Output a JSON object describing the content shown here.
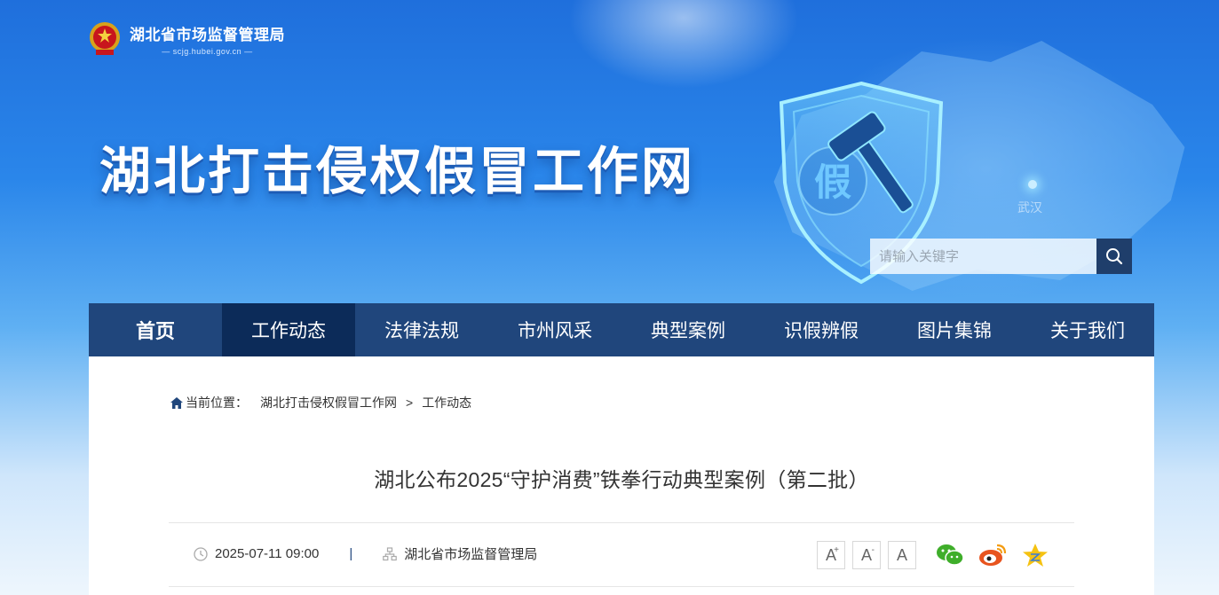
{
  "header": {
    "agency_name": "湖北省市场监督管理局",
    "agency_url": "— scjg.hubei.gov.cn —",
    "site_title": "湖北打击侵权假冒工作网",
    "map_label": "武汉",
    "shield_char": "假"
  },
  "search": {
    "placeholder": "请输入关键字"
  },
  "nav": {
    "items": [
      {
        "label": "首页"
      },
      {
        "label": "工作动态"
      },
      {
        "label": "法律法规"
      },
      {
        "label": "市州风采"
      },
      {
        "label": "典型案例"
      },
      {
        "label": "识假辨假"
      },
      {
        "label": "图片集锦"
      },
      {
        "label": "关于我们"
      }
    ],
    "active_index": 1
  },
  "breadcrumb": {
    "label": "当前位置：",
    "items": [
      "湖北打击侵权假冒工作网",
      "工作动态"
    ],
    "separator": ">"
  },
  "article": {
    "title": "湖北公布2025“守护消费”铁拳行动典型案例（第二批）",
    "date": "2025-07-11 09:00",
    "divider": "|",
    "source": "湖北省市场监督管理局"
  },
  "font_controls": {
    "increase": "A",
    "decrease": "A",
    "reset": "A",
    "increase_sup": "+",
    "decrease_sup": "-"
  },
  "share": {
    "icons": [
      "wechat-icon",
      "weibo-icon",
      "qzone-icon"
    ]
  },
  "colors": {
    "nav_bg": "#20467c",
    "nav_active": "#0c2b59",
    "search_btn": "#1f3e6b"
  }
}
